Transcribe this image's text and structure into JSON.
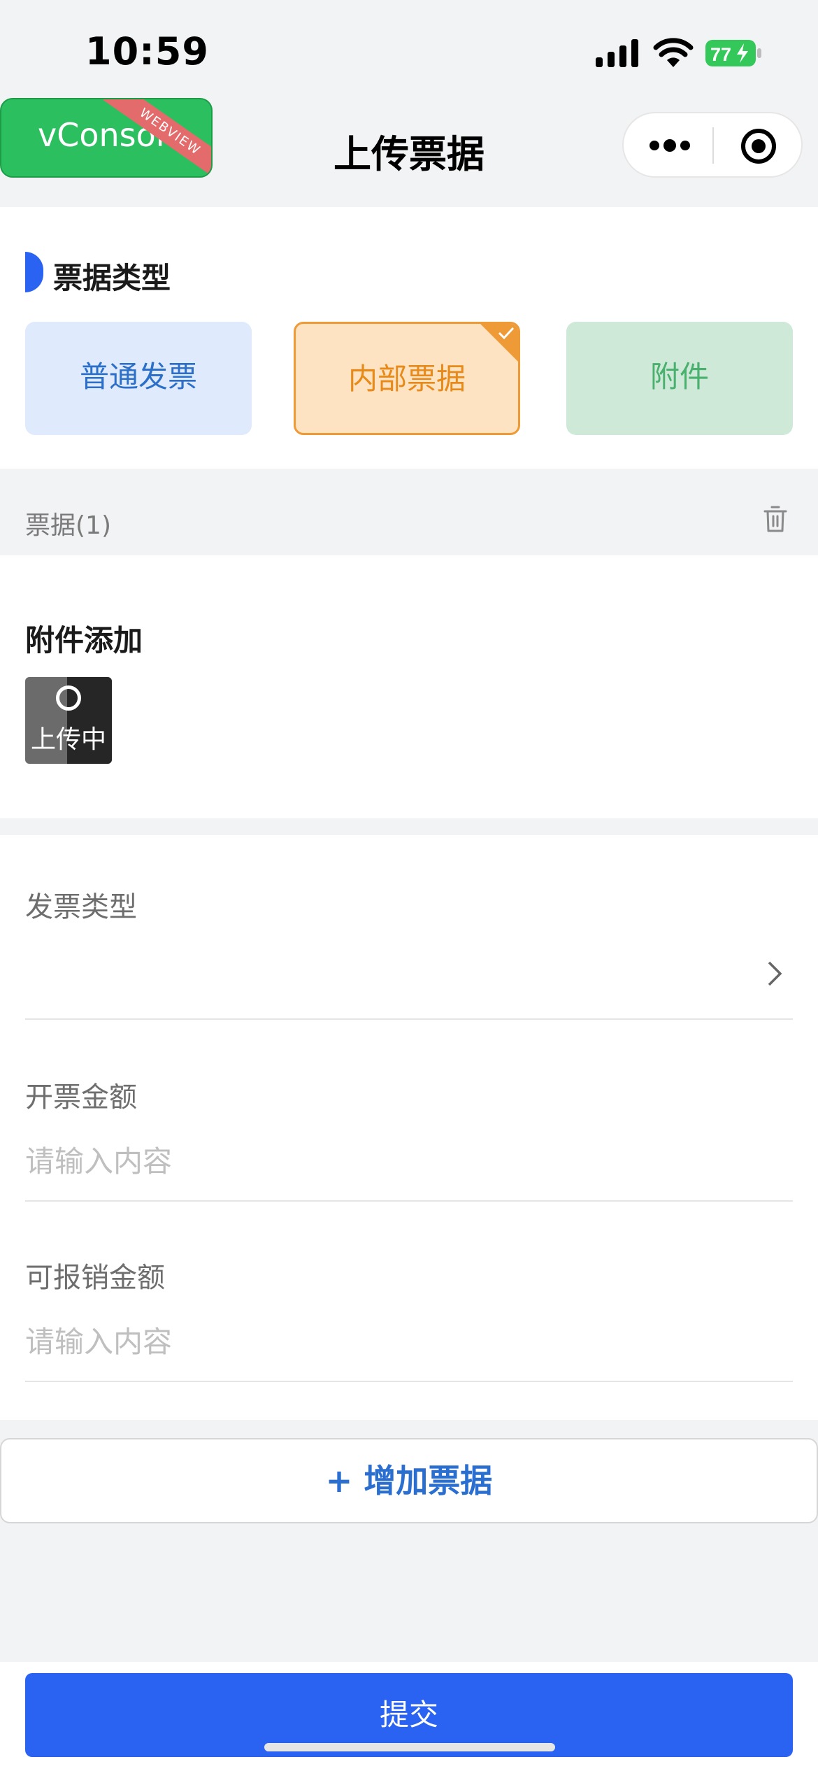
{
  "status_bar": {
    "time": "10:59",
    "battery_level": "77"
  },
  "nav": {
    "vconsole_label": "vConsole",
    "vconsole_badge": "WEBVIEW",
    "title": "上传票据"
  },
  "receipt_type": {
    "section_title": "票据类型",
    "options": [
      {
        "label": "普通发票",
        "selected": false
      },
      {
        "label": "内部票据",
        "selected": true
      },
      {
        "label": "附件",
        "selected": false
      }
    ]
  },
  "receipt": {
    "header_label": "票据(1)",
    "attachment_title": "附件添加",
    "upload_status": "上传中"
  },
  "form": {
    "invoice_type_label": "发票类型",
    "invoice_type_value": "",
    "amount_label": "开票金额",
    "amount_placeholder": "请输入内容",
    "reimbursable_label": "可报销金额",
    "reimbursable_placeholder": "请输入内容"
  },
  "actions": {
    "add_receipt": "+ 增加票据",
    "submit": "提交"
  },
  "colors": {
    "primary": "#2a63f2",
    "selected_orange": "#ee9a36",
    "vconsole_green": "#2cbf60"
  }
}
